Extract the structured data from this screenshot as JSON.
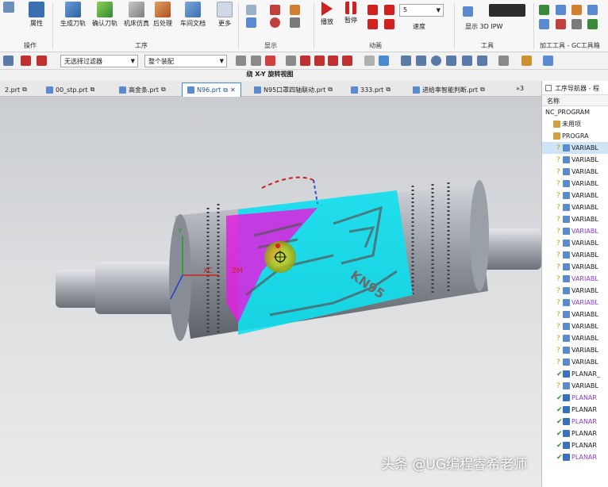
{
  "ribbon": {
    "buttons": [
      {
        "label": "属性"
      },
      {
        "label": "生成刀轨"
      },
      {
        "label": "确认刀轨"
      },
      {
        "label": "机床仿真"
      },
      {
        "label": "后处理"
      },
      {
        "label": "车间文档"
      },
      {
        "label": "更多"
      }
    ],
    "groups": {
      "operate": "操作",
      "process": "工序",
      "display": "显示",
      "animation": "动画",
      "tools": "工具",
      "gc_tools": "加工工具 - GC工具箱"
    },
    "play_label": "播放",
    "pause_label": "暂停",
    "speed_label": "速度",
    "speed_value": "5",
    "ipw_label": "显示 3D IPW"
  },
  "toolbar2": {
    "filter_select": "无选择过滤器",
    "assembly_select": "整个装配"
  },
  "view_title": "绕 X-Y 旋转视图",
  "tabs": [
    {
      "label": "2.prt"
    },
    {
      "label": "00_stp.prt"
    },
    {
      "label": "高金条.prt"
    },
    {
      "label": "N96.prt"
    },
    {
      "label": "N95口罩四轴联动.prt"
    },
    {
      "label": "333.prt"
    },
    {
      "label": "进给率智能判断.prt"
    }
  ],
  "tab_overflow": "3",
  "viewport": {
    "axis_x": "XC",
    "axis_y": "Y",
    "axis_z": "ZM",
    "axis_m": "M",
    "engraving": "KN95"
  },
  "navigator": {
    "title": "工序导航器 - 程",
    "column": "名称",
    "root": "NC_PROGRAM",
    "unused": "未用项",
    "program": "PROGRA",
    "rows": [
      {
        "label": "VARIABL",
        "color": "#1a1a1a"
      },
      {
        "label": "VARIABL",
        "color": "#1a1a1a"
      },
      {
        "label": "VARIABL",
        "color": "#1a1a1a"
      },
      {
        "label": "VARIABL",
        "color": "#1a1a1a"
      },
      {
        "label": "VARIABL",
        "color": "#1a1a1a"
      },
      {
        "label": "VARIABL",
        "color": "#1a1a1a"
      },
      {
        "label": "VARIABL",
        "color": "#1a1a1a"
      },
      {
        "label": "VARIABL",
        "color": "#8a3ad0"
      },
      {
        "label": "VARIABL",
        "color": "#1a1a1a"
      },
      {
        "label": "VARIABL",
        "color": "#1a1a1a"
      },
      {
        "label": "VARIABL",
        "color": "#1a1a1a"
      },
      {
        "label": "VARIABL",
        "color": "#8a3ad0"
      },
      {
        "label": "VARIABL",
        "color": "#1a1a1a"
      },
      {
        "label": "VARIABL",
        "color": "#8a3ad0"
      },
      {
        "label": "VARIABL",
        "color": "#1a1a1a"
      },
      {
        "label": "VARIABL",
        "color": "#1a1a1a"
      },
      {
        "label": "VARIABL",
        "color": "#1a1a1a"
      },
      {
        "label": "VARIABL",
        "color": "#1a1a1a"
      },
      {
        "label": "VARIABL",
        "color": "#1a1a1a"
      },
      {
        "label": "PLANAR_",
        "color": "#1a1a1a"
      },
      {
        "label": "VARIABL",
        "color": "#1a1a1a"
      },
      {
        "label": "PLANAR",
        "color": "#8a3ad0"
      },
      {
        "label": "PLANAR",
        "color": "#1a1a1a"
      },
      {
        "label": "PLANAR",
        "color": "#8a3ad0"
      },
      {
        "label": "PLANAR",
        "color": "#1a1a1a"
      },
      {
        "label": "PLANAR",
        "color": "#1a1a1a"
      },
      {
        "label": "PLANAR",
        "color": "#8a3ad0"
      }
    ]
  },
  "watermark": "头条 @UG编程睿希老师"
}
